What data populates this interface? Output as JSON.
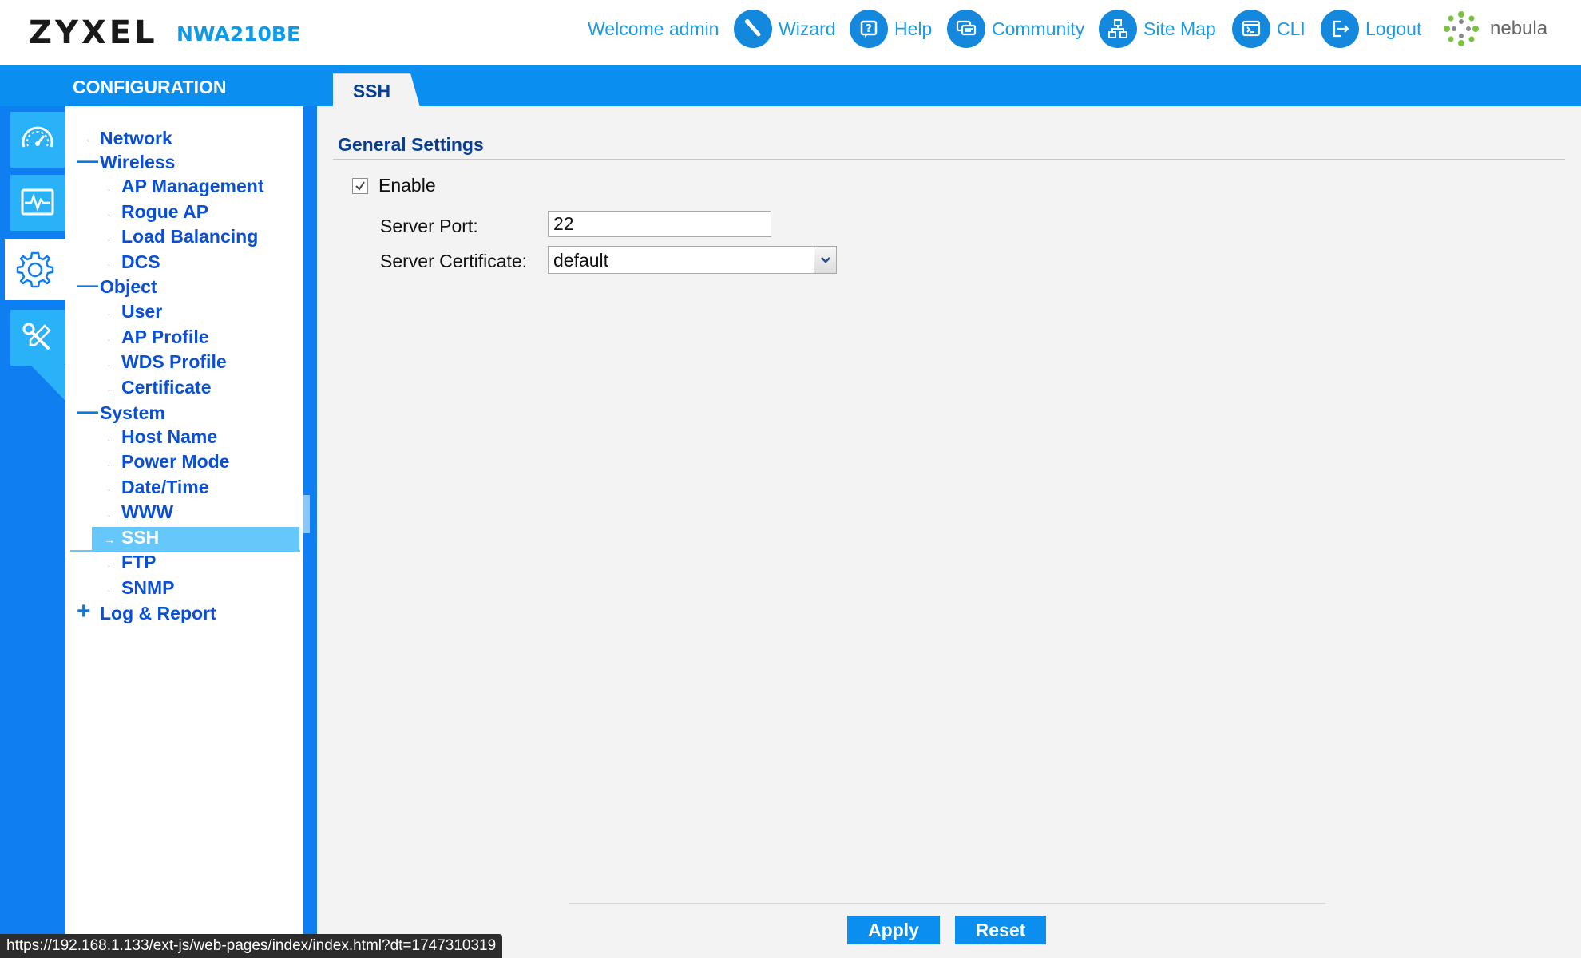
{
  "header": {
    "brand": "ZYXEL",
    "model": "NWA210BE",
    "welcome": "Welcome admin",
    "links": [
      {
        "label": "Wizard",
        "icon": "wand-icon"
      },
      {
        "label": "Help",
        "icon": "help-icon"
      },
      {
        "label": "Community",
        "icon": "chat-icon"
      },
      {
        "label": "Site Map",
        "icon": "sitemap-icon"
      },
      {
        "label": "CLI",
        "icon": "terminal-icon"
      },
      {
        "label": "Logout",
        "icon": "logout-icon"
      }
    ],
    "nebula_label": "nebula"
  },
  "panel_title": "CONFIGURATION",
  "tab": {
    "label": "SSH"
  },
  "rail": [
    {
      "name": "dashboard",
      "icon": "speedometer-icon"
    },
    {
      "name": "monitor",
      "icon": "pulse-icon"
    },
    {
      "name": "configuration",
      "icon": "gear-icon",
      "selected": true
    },
    {
      "name": "maintenance",
      "icon": "tools-icon"
    }
  ],
  "nav": {
    "network": "Network",
    "wireless": "Wireless",
    "ap_management": "AP Management",
    "rogue_ap": "Rogue AP",
    "load_balancing": "Load Balancing",
    "dcs": "DCS",
    "object": "Object",
    "user": "User",
    "ap_profile": "AP Profile",
    "wds_profile": "WDS Profile",
    "certificate": "Certificate",
    "system": "System",
    "host_name": "Host Name",
    "power_mode": "Power Mode",
    "date_time": "Date/Time",
    "www": "WWW",
    "ssh": "SSH",
    "ftp": "FTP",
    "snmp": "SNMP",
    "log_report": "Log & Report",
    "selected": "SSH"
  },
  "form": {
    "section_title": "General Settings",
    "enable_label": "Enable",
    "enable_checked": true,
    "server_port_label": "Server Port:",
    "server_port_value": "22",
    "server_cert_label": "Server Certificate:",
    "server_cert_value": "default",
    "apply_label": "Apply",
    "reset_label": "Reset"
  },
  "status_url": "https://192.168.1.133/ext-js/web-pages/index/index.html?dt=1747310319",
  "colors": {
    "primary_blue": "#0a8ff0",
    "rail_button": "#29b2f7",
    "nav_text": "#0b4fd2",
    "selected_row": "#65c7fa",
    "header_link": "#1a9be6"
  }
}
